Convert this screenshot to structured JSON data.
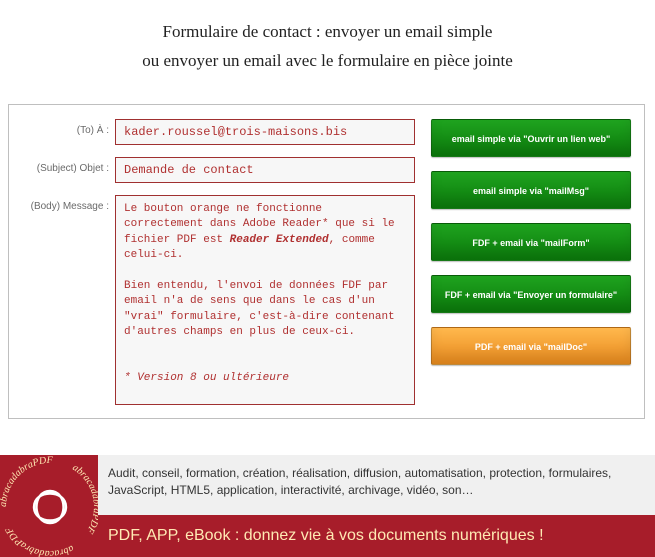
{
  "title": {
    "line1": "Formulaire de contact : envoyer un email simple",
    "line2": "ou envoyer un email avec le formulaire en pièce jointe"
  },
  "form": {
    "to_label": "(To) À :",
    "to_value": "kader.roussel@trois-maisons.bis",
    "subject_label": "(Subject) Objet :",
    "subject_value": "Demande de contact",
    "body_label": "(Body) Message :",
    "body_p1": "Le bouton orange ne fonctionne correctement dans Adobe Reader* que si le fichier PDF est ",
    "body_strong": "Reader Extended",
    "body_p1_tail": ", comme celui-ci.",
    "body_p2": "Bien entendu, l'envoi de données FDF par email n'a de sens que dans le cas d'un \"vrai\" formulaire, c'est-à-dire contenant d'autres champs en plus de ceux-ci.",
    "body_footnote": "* Version 8 ou ultérieure"
  },
  "buttons": {
    "b1": "email simple via \"Ouvrir un lien web\"",
    "b2": "email simple via \"mailMsg\"",
    "b3": "FDF + email via \"mailForm\"",
    "b4": "FDF + email via \"Envoyer un formulaire\"",
    "b5": "PDF + email via \"mailDoc\""
  },
  "footer": {
    "logo_text": "abracadabraPDF",
    "desc": "Audit, conseil, formation, création, réalisation, diffusion, automatisation, protection, formulaires, JavaScript, HTML5, application, interactivité, archivage, vidéo, son…",
    "tagline": "PDF, APP, eBook : donnez vie à vos documents numériques !"
  }
}
